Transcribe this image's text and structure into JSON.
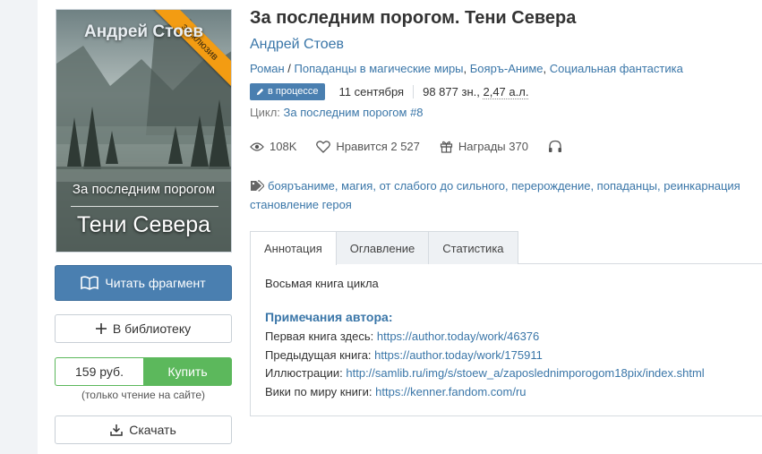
{
  "cover": {
    "author": "Андрей Стоев",
    "series": "За последним порогом",
    "title": "Тени Севера",
    "ribbon": "эксклюзив"
  },
  "actions": {
    "read_label": "Читать фрагмент",
    "library_label": "В библиотеку",
    "price": "159 руб.",
    "buy_label": "Купить",
    "buy_note": "(только чтение на сайте)",
    "download_label": "Скачать"
  },
  "book": {
    "title": "За последним порогом. Тени Севера",
    "author": "Андрей Стоев",
    "genres": [
      "Роман",
      "Попаданцы в магические миры",
      "Бояръ-Аниме",
      "Социальная фантастика"
    ],
    "status": "в процессе",
    "date": "11 сентября",
    "size_chars": "98 877 зн.,",
    "size_al": "2,47 а.л.",
    "cycle_label": "Цикл:",
    "cycle_name": "За последним порогом #8"
  },
  "stats": {
    "views": "108K",
    "likes": "Нравится 2 527",
    "awards": "Награды 370"
  },
  "tags": {
    "line1": "бояръаниме, магия, от слабого до сильного, перерождение, попаданцы, реинкарнация",
    "line2": "становление героя"
  },
  "tabs": [
    "Аннотация",
    "Оглавление",
    "Статистика"
  ],
  "annotation": {
    "text": "Восьмая книга цикла",
    "notes_title": "Примечания автора:",
    "notes": [
      {
        "label": "Первая книга здесь:",
        "link": "https://author.today/work/46376"
      },
      {
        "label": "Предыдущая книга:",
        "link": "https://author.today/work/175911"
      },
      {
        "label": "Иллюстрации:",
        "link": "http://samlib.ru/img/s/stoew_a/zaposlednimporogom18pix/index.shtml"
      },
      {
        "label": "Вики по миру книги:",
        "link": "https://kenner.fandom.com/ru"
      }
    ]
  },
  "colors": {
    "accent": "#4a7fb0",
    "link": "#3a76a8",
    "buy": "#5cb85c",
    "ribbon": "#f39c12"
  }
}
